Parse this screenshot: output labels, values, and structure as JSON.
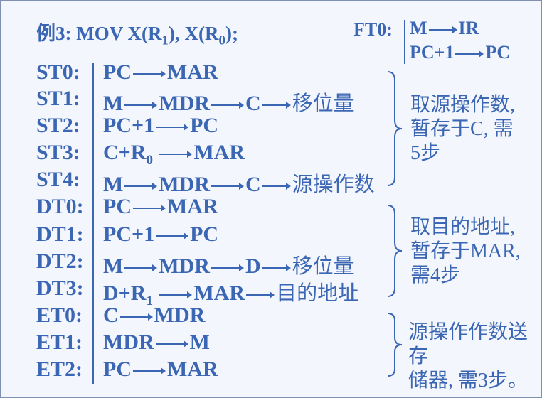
{
  "title": "例3: MOV X(R1), X(R0);",
  "title_parts": {
    "a": "例3: MOV X(R",
    "b": "1",
    "c": "),  X(R",
    "d": "0",
    "e": ");"
  },
  "fetch": {
    "label": "FT0:",
    "lines": [
      "M→IR",
      "PC+1→PC"
    ]
  },
  "steps": [
    {
      "label": "ST0:",
      "op": "PC→MAR"
    },
    {
      "label": "ST1:",
      "op": "M→MDR→C",
      "note": "移位量"
    },
    {
      "label": "ST2:",
      "op": "PC+1→PC"
    },
    {
      "label": "ST3:",
      "op": "C+R0→MAR"
    },
    {
      "label": "ST4:",
      "op": "M→MDR→C",
      "note": "源操作数"
    },
    {
      "label": "DT0:",
      "op": "PC→MAR"
    },
    {
      "label": "DT1:",
      "op": "PC+1→PC"
    },
    {
      "label": "DT2:",
      "op": "M→MDR→D",
      "note": "移位量"
    },
    {
      "label": "DT3:",
      "op": "D+R1→MAR",
      "note": "目的地址"
    },
    {
      "label": "ET0:",
      "op": "C→MDR"
    },
    {
      "label": "ET1:",
      "op": "MDR→M"
    },
    {
      "label": "ET2:",
      "op": "PC→MAR"
    }
  ],
  "op_parts": {
    "pc": "PC",
    "mar": "MAR",
    "m": "M",
    "mdr": "MDR",
    "c": "C",
    "d": "D",
    "pc1": "PC+1",
    "cplusr": "C+R",
    "dplusr": "D+R",
    "sub0": "0",
    "sub1": "1",
    "ir": "IR"
  },
  "annotations": [
    "取源操作数, 暂存于C, 需5步",
    "取目的地址, 暂存于MAR, 需4步",
    "源操作作数送存储器, 需3步。"
  ],
  "annotation_lines": {
    "src": [
      "取源操作数,",
      "暂存于C, 需",
      "5步"
    ],
    "dst": [
      "取目的地址,",
      "暂存于MAR,",
      "需4步"
    ],
    "exe": [
      "源操作作数送存",
      "储器, 需3步。"
    ]
  },
  "colors": {
    "text": "#3a66b3",
    "background": "#f4f6fd",
    "border": "#7f8fb0"
  }
}
